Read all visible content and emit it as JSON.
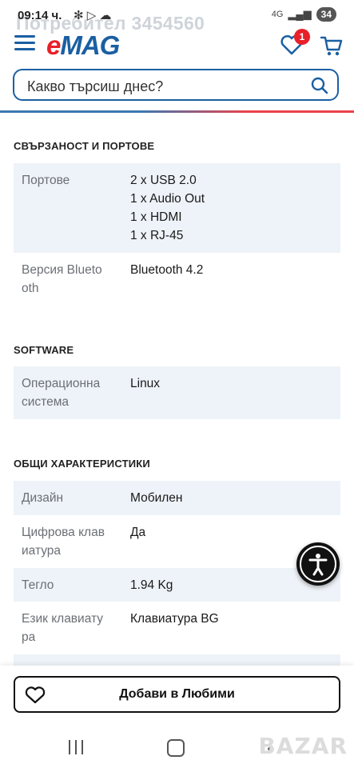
{
  "status_bar": {
    "time": "09:14 ч.",
    "ghost_text": "Потребител 3454560",
    "icons": [
      "pinwheel-icon",
      "play-icon",
      "cloud-icon"
    ],
    "network": "4G",
    "battery": "34"
  },
  "header": {
    "logo_e": "e",
    "logo_mag": "MAG",
    "favorites_count": "1"
  },
  "search": {
    "placeholder": "Какво търсиш днес?"
  },
  "sections": [
    {
      "title": "СВЪРЗАНОСТ И ПОРТОВЕ",
      "rows": [
        {
          "label": "Портове",
          "values": [
            "2 x USB 2.0",
            "1 x Audio Out",
            "1 x HDMI",
            "1 x RJ-45"
          ]
        },
        {
          "label": "Версия Bluetooth",
          "values": [
            "Bluetooth 4.2"
          ]
        }
      ]
    },
    {
      "title": "SOFTWARE",
      "rows": [
        {
          "label": "Операционна система",
          "values": [
            "Linux"
          ]
        }
      ]
    },
    {
      "title": "ОБЩИ ХАРАКТЕРИСТИКИ",
      "rows": [
        {
          "label": "Дизайн",
          "values": [
            "Мобилен"
          ]
        },
        {
          "label": "Цифрова клавиатура",
          "values": [
            "Да"
          ]
        },
        {
          "label": "Тегло",
          "values": [
            "1.94 Kg"
          ]
        },
        {
          "label": "Език клавиатура",
          "values": [
            "Клавиатура BG"
          ]
        }
      ]
    }
  ],
  "label_breaks": {
    "bluetooth": [
      "Версия Blueto",
      "oth"
    ],
    "os": [
      "Операционна",
      "система"
    ],
    "numpad": [
      "Цифрова клав",
      "иатура"
    ],
    "keyboard_lang": [
      "Език клавиату",
      "ра"
    ]
  },
  "bottom": {
    "add_to_favorites": "Добави в Любими"
  },
  "watermark": "BAZAR",
  "colors": {
    "brand_blue": "#1a5fa3",
    "brand_red": "#e8202a",
    "row_shade": "#eef3f9"
  }
}
